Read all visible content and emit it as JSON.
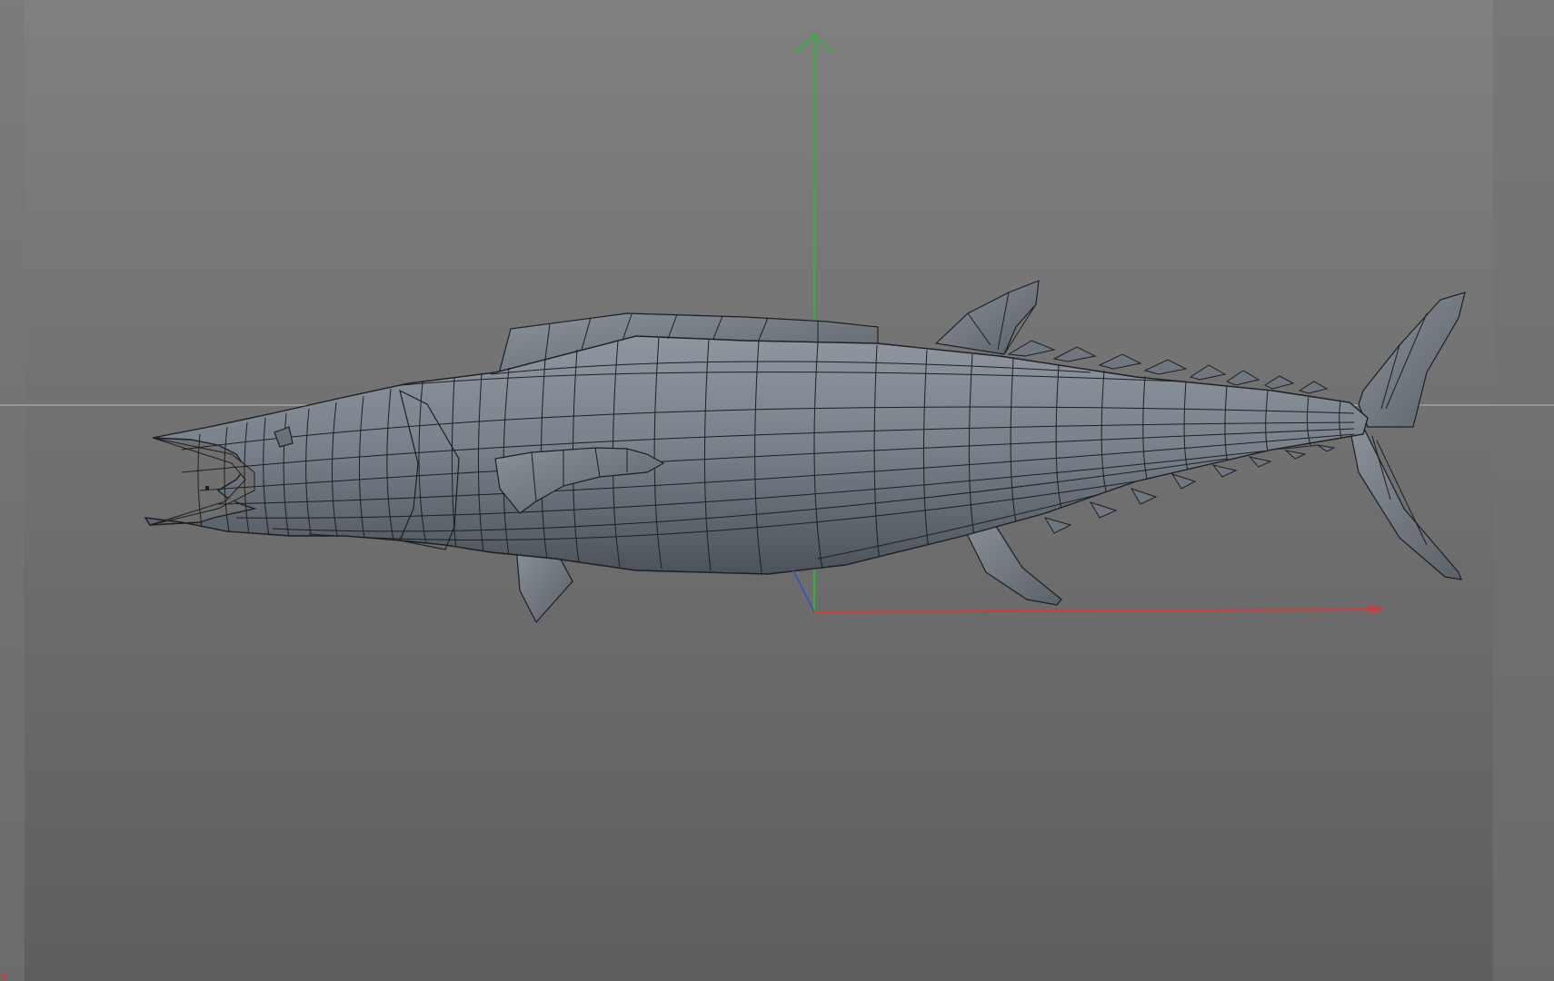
{
  "viewport": {
    "title": "",
    "background_top": "#7e7e7e",
    "background_bottom": "#5f5f5f",
    "gutter_color": "#6e6e6e"
  },
  "axes": {
    "x_color": "#d23a3a",
    "y_color": "#2fb43a",
    "z_color": "#3a4fd2"
  },
  "model": {
    "name": "",
    "display": "wireframe-shaded",
    "body_color": "#6f767f",
    "wire_color": "#1c1f22",
    "icon": "fish-mesh"
  },
  "icons": [
    "axis-gizmo",
    "horizon-line",
    "corner-marker"
  ]
}
